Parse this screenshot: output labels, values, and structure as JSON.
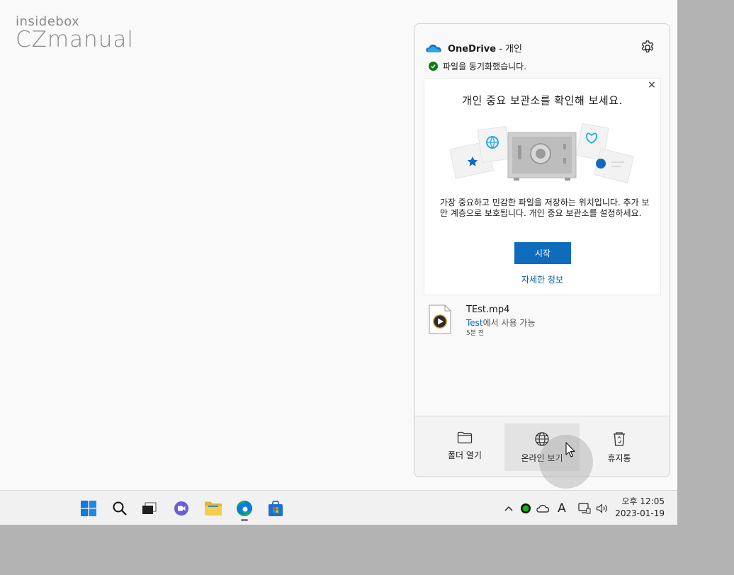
{
  "watermark": {
    "line1": "insidebox",
    "line2": "CZmanual"
  },
  "onedrive": {
    "title_bold": "OneDrive",
    "title_rest": " - 개인",
    "sync_status": "파일을 동기화했습니다.",
    "vault": {
      "heading": "개인 중요 보관소를 확인해 보세요.",
      "description": "가장 중요하고 민감한 파일을 저장하는 위치입니다. 추가 보안 계층으로 보호됩니다. 개인 중요 보관소를 설정하세요.",
      "start_label": "시작",
      "more_label": "자세한 정보",
      "close_label": "×"
    },
    "file": {
      "name": "TEst.mp4",
      "location_link": "Test",
      "location_suffix": "에서 사용 가능",
      "time": "5분 전"
    },
    "footer": {
      "open_folder": "폴더 열기",
      "view_online": "온라인 보기",
      "recycle_bin": "휴지통"
    }
  },
  "taskbar": {
    "tray_chevron": "^",
    "ime": "A",
    "clock_time": "오후 12:05",
    "clock_date": "2023-01-19"
  },
  "colors": {
    "accent": "#0f6cbd",
    "sync_ok": "#107c10",
    "tray_green": "#0cb80c"
  }
}
